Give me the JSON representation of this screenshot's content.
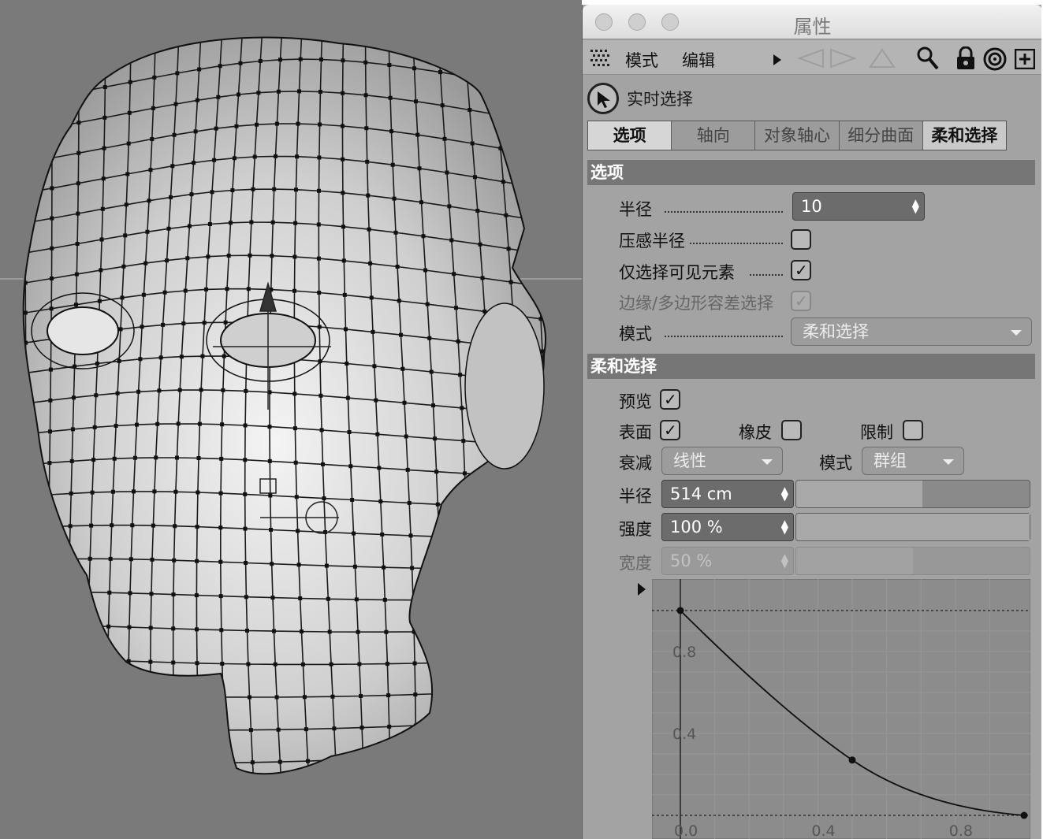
{
  "window": {
    "title": "属性"
  },
  "menu": {
    "mode": "模式",
    "edit": "编辑"
  },
  "tool": {
    "name": "实时选择"
  },
  "tabs": [
    "选项",
    "轴向",
    "对象轴心",
    "细分曲面",
    "柔和选择"
  ],
  "options_section": {
    "header": "选项",
    "radius_label": "半径",
    "radius_value": "10",
    "pressure_radius_label": "压感半径",
    "pressure_radius_checked": false,
    "visible_only_label": "仅选择可见元素",
    "visible_only_checked": true,
    "edge_tolerance_label": "边缘/多边形容差选择",
    "edge_tolerance_checked": true,
    "mode_label": "模式",
    "mode_value": "柔和选择"
  },
  "soft_section": {
    "header": "柔和选择",
    "preview_label": "预览",
    "preview_checked": true,
    "surface_label": "表面",
    "surface_checked": true,
    "rubber_label": "橡皮",
    "rubber_checked": false,
    "restrict_label": "限制",
    "restrict_checked": false,
    "falloff_label": "衰减",
    "falloff_value": "线性",
    "mode_label": "模式",
    "mode_value": "群组",
    "radius_label": "半径",
    "radius_value": "514 cm",
    "radius_fraction": 0.54,
    "strength_label": "强度",
    "strength_value": "100 %",
    "strength_fraction": 1.0,
    "width_label": "宽度",
    "width_value": "50 %",
    "width_fraction": 0.5
  },
  "chart_data": {
    "type": "line",
    "x": [
      0.0,
      0.5,
      1.0
    ],
    "y": [
      1.0,
      0.27,
      0.0
    ],
    "xlim": [
      0,
      1
    ],
    "ylim": [
      0,
      1
    ],
    "xticks": [
      "0.0",
      "0.4",
      "0.8"
    ],
    "yticks": [
      "0.8",
      "0.4"
    ]
  }
}
